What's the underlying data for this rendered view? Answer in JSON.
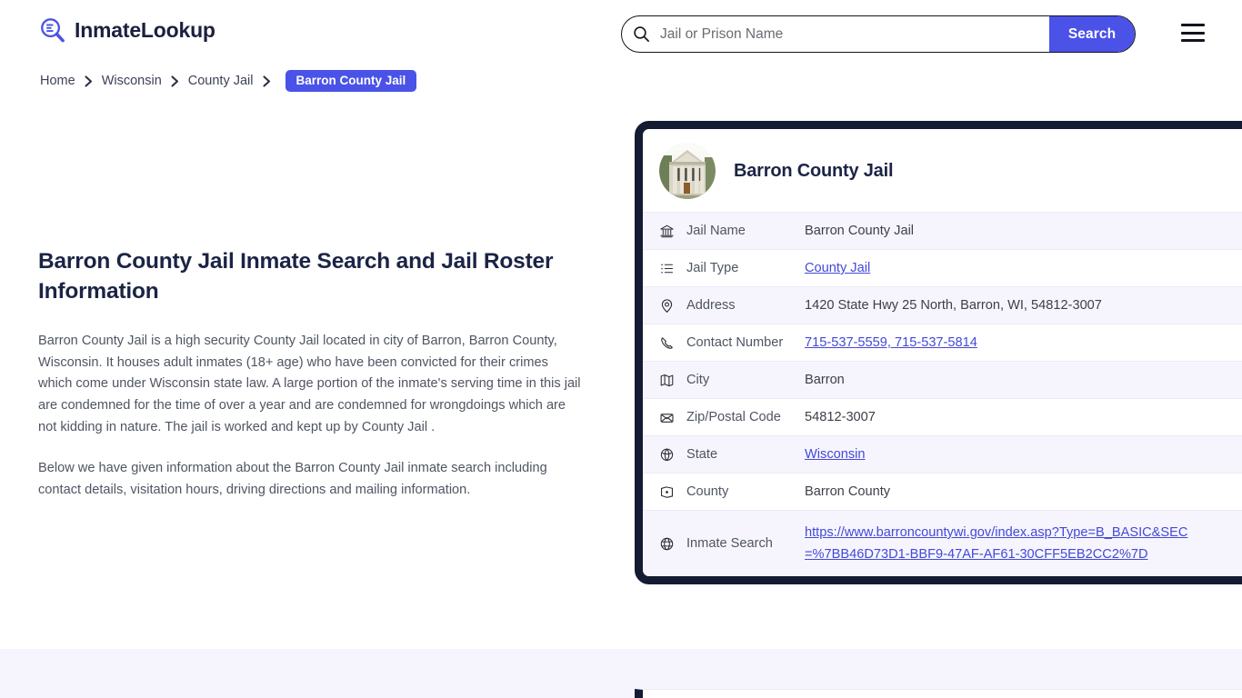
{
  "header": {
    "brand_name": "InmateLookup",
    "brand_icon": "magnifier-list-icon",
    "search": {
      "placeholder": "Jail or Prison Name",
      "value": "",
      "button_label": "Search",
      "icon": "search-icon"
    },
    "menu_icon": "hamburger-menu-icon"
  },
  "breadcrumb": {
    "items": [
      {
        "label": "Home",
        "current": false
      },
      {
        "label": "Wisconsin",
        "current": false
      },
      {
        "label": "County Jail",
        "current": false
      },
      {
        "label": "Barron County Jail",
        "current": true
      }
    ],
    "separator": "❯"
  },
  "main": {
    "title": "Barron County Jail Inmate Search and Jail Roster Information",
    "paragraphs": [
      "Barron County Jail is a high security County Jail located in city of Barron, Barron County, Wisconsin. It houses adult inmates (18+ age) who have been convicted for their crimes which come under Wisconsin state law. A large portion of the inmate's serving time in this jail are condemned for the time of over a year and are condemned for wrongdoings which are not kidding in nature. The jail is worked and kept up by County Jail .",
      "Below we have given information about the Barron County Jail inmate search including contact details, visitation hours, driving directions and mailing information."
    ]
  },
  "card": {
    "title": "Barron County Jail",
    "avatar_icon": "courthouse-photo",
    "rows": [
      {
        "icon": "bank-building-icon",
        "label": "Jail Name",
        "value": "Barron County Jail",
        "is_link": false
      },
      {
        "icon": "list-icon",
        "label": "Jail Type",
        "value": "County Jail",
        "is_link": true
      },
      {
        "icon": "map-pin-icon",
        "label": "Address",
        "value": "1420 State Hwy 25 North, Barron, WI, 54812-3007",
        "is_link": false
      },
      {
        "icon": "phone-icon",
        "label": "Contact Number",
        "value": "715-537-5559, 715-537-5814",
        "is_link": true
      },
      {
        "icon": "map-icon",
        "label": "City",
        "value": "Barron",
        "is_link": false
      },
      {
        "icon": "envelope-icon",
        "label": "Zip/Postal Code",
        "value": "54812-3007",
        "is_link": false
      },
      {
        "icon": "globe-shield-icon",
        "label": "State",
        "value": "Wisconsin",
        "is_link": true
      },
      {
        "icon": "county-map-icon",
        "label": "County",
        "value": "Barron County",
        "is_link": false
      },
      {
        "icon": "globe-icon",
        "label": "Inmate Search",
        "value": "https://www.barroncountywi.gov/index.asp?Type=B_BASIC&SEC=%7BB46D73D1-BBF9-47AF-AF61-30CFF5EB2CC2%7D",
        "is_link": true
      }
    ]
  },
  "colors": {
    "accent": "#4a52e8",
    "link": "#4349d8",
    "card_border": "#141c33",
    "row_alt": "#f6f5fd",
    "heading": "#1b2445",
    "body_text": "#4f5562"
  }
}
